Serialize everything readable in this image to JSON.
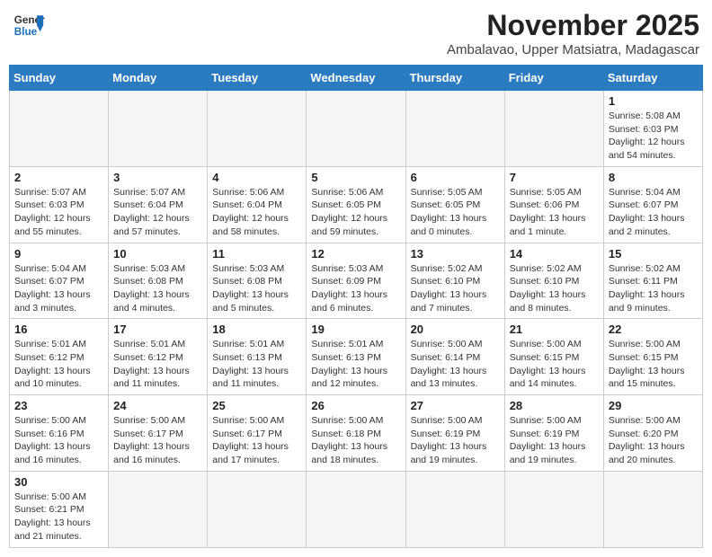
{
  "logo": {
    "line1": "General",
    "line2": "Blue"
  },
  "title": "November 2025",
  "subtitle": "Ambalavao, Upper Matsiatra, Madagascar",
  "days_of_week": [
    "Sunday",
    "Monday",
    "Tuesday",
    "Wednesday",
    "Thursday",
    "Friday",
    "Saturday"
  ],
  "weeks": [
    [
      {
        "day": "",
        "info": ""
      },
      {
        "day": "",
        "info": ""
      },
      {
        "day": "",
        "info": ""
      },
      {
        "day": "",
        "info": ""
      },
      {
        "day": "",
        "info": ""
      },
      {
        "day": "",
        "info": ""
      },
      {
        "day": "1",
        "info": "Sunrise: 5:08 AM\nSunset: 6:03 PM\nDaylight: 12 hours and 54 minutes."
      }
    ],
    [
      {
        "day": "2",
        "info": "Sunrise: 5:07 AM\nSunset: 6:03 PM\nDaylight: 12 hours and 55 minutes."
      },
      {
        "day": "3",
        "info": "Sunrise: 5:07 AM\nSunset: 6:04 PM\nDaylight: 12 hours and 57 minutes."
      },
      {
        "day": "4",
        "info": "Sunrise: 5:06 AM\nSunset: 6:04 PM\nDaylight: 12 hours and 58 minutes."
      },
      {
        "day": "5",
        "info": "Sunrise: 5:06 AM\nSunset: 6:05 PM\nDaylight: 12 hours and 59 minutes."
      },
      {
        "day": "6",
        "info": "Sunrise: 5:05 AM\nSunset: 6:05 PM\nDaylight: 13 hours and 0 minutes."
      },
      {
        "day": "7",
        "info": "Sunrise: 5:05 AM\nSunset: 6:06 PM\nDaylight: 13 hours and 1 minute."
      },
      {
        "day": "8",
        "info": "Sunrise: 5:04 AM\nSunset: 6:07 PM\nDaylight: 13 hours and 2 minutes."
      }
    ],
    [
      {
        "day": "9",
        "info": "Sunrise: 5:04 AM\nSunset: 6:07 PM\nDaylight: 13 hours and 3 minutes."
      },
      {
        "day": "10",
        "info": "Sunrise: 5:03 AM\nSunset: 6:08 PM\nDaylight: 13 hours and 4 minutes."
      },
      {
        "day": "11",
        "info": "Sunrise: 5:03 AM\nSunset: 6:08 PM\nDaylight: 13 hours and 5 minutes."
      },
      {
        "day": "12",
        "info": "Sunrise: 5:03 AM\nSunset: 6:09 PM\nDaylight: 13 hours and 6 minutes."
      },
      {
        "day": "13",
        "info": "Sunrise: 5:02 AM\nSunset: 6:10 PM\nDaylight: 13 hours and 7 minutes."
      },
      {
        "day": "14",
        "info": "Sunrise: 5:02 AM\nSunset: 6:10 PM\nDaylight: 13 hours and 8 minutes."
      },
      {
        "day": "15",
        "info": "Sunrise: 5:02 AM\nSunset: 6:11 PM\nDaylight: 13 hours and 9 minutes."
      }
    ],
    [
      {
        "day": "16",
        "info": "Sunrise: 5:01 AM\nSunset: 6:12 PM\nDaylight: 13 hours and 10 minutes."
      },
      {
        "day": "17",
        "info": "Sunrise: 5:01 AM\nSunset: 6:12 PM\nDaylight: 13 hours and 11 minutes."
      },
      {
        "day": "18",
        "info": "Sunrise: 5:01 AM\nSunset: 6:13 PM\nDaylight: 13 hours and 11 minutes."
      },
      {
        "day": "19",
        "info": "Sunrise: 5:01 AM\nSunset: 6:13 PM\nDaylight: 13 hours and 12 minutes."
      },
      {
        "day": "20",
        "info": "Sunrise: 5:00 AM\nSunset: 6:14 PM\nDaylight: 13 hours and 13 minutes."
      },
      {
        "day": "21",
        "info": "Sunrise: 5:00 AM\nSunset: 6:15 PM\nDaylight: 13 hours and 14 minutes."
      },
      {
        "day": "22",
        "info": "Sunrise: 5:00 AM\nSunset: 6:15 PM\nDaylight: 13 hours and 15 minutes."
      }
    ],
    [
      {
        "day": "23",
        "info": "Sunrise: 5:00 AM\nSunset: 6:16 PM\nDaylight: 13 hours and 16 minutes."
      },
      {
        "day": "24",
        "info": "Sunrise: 5:00 AM\nSunset: 6:17 PM\nDaylight: 13 hours and 16 minutes."
      },
      {
        "day": "25",
        "info": "Sunrise: 5:00 AM\nSunset: 6:17 PM\nDaylight: 13 hours and 17 minutes."
      },
      {
        "day": "26",
        "info": "Sunrise: 5:00 AM\nSunset: 6:18 PM\nDaylight: 13 hours and 18 minutes."
      },
      {
        "day": "27",
        "info": "Sunrise: 5:00 AM\nSunset: 6:19 PM\nDaylight: 13 hours and 19 minutes."
      },
      {
        "day": "28",
        "info": "Sunrise: 5:00 AM\nSunset: 6:19 PM\nDaylight: 13 hours and 19 minutes."
      },
      {
        "day": "29",
        "info": "Sunrise: 5:00 AM\nSunset: 6:20 PM\nDaylight: 13 hours and 20 minutes."
      }
    ],
    [
      {
        "day": "30",
        "info": "Sunrise: 5:00 AM\nSunset: 6:21 PM\nDaylight: 13 hours and 21 minutes."
      },
      {
        "day": "",
        "info": ""
      },
      {
        "day": "",
        "info": ""
      },
      {
        "day": "",
        "info": ""
      },
      {
        "day": "",
        "info": ""
      },
      {
        "day": "",
        "info": ""
      },
      {
        "day": "",
        "info": ""
      }
    ]
  ]
}
